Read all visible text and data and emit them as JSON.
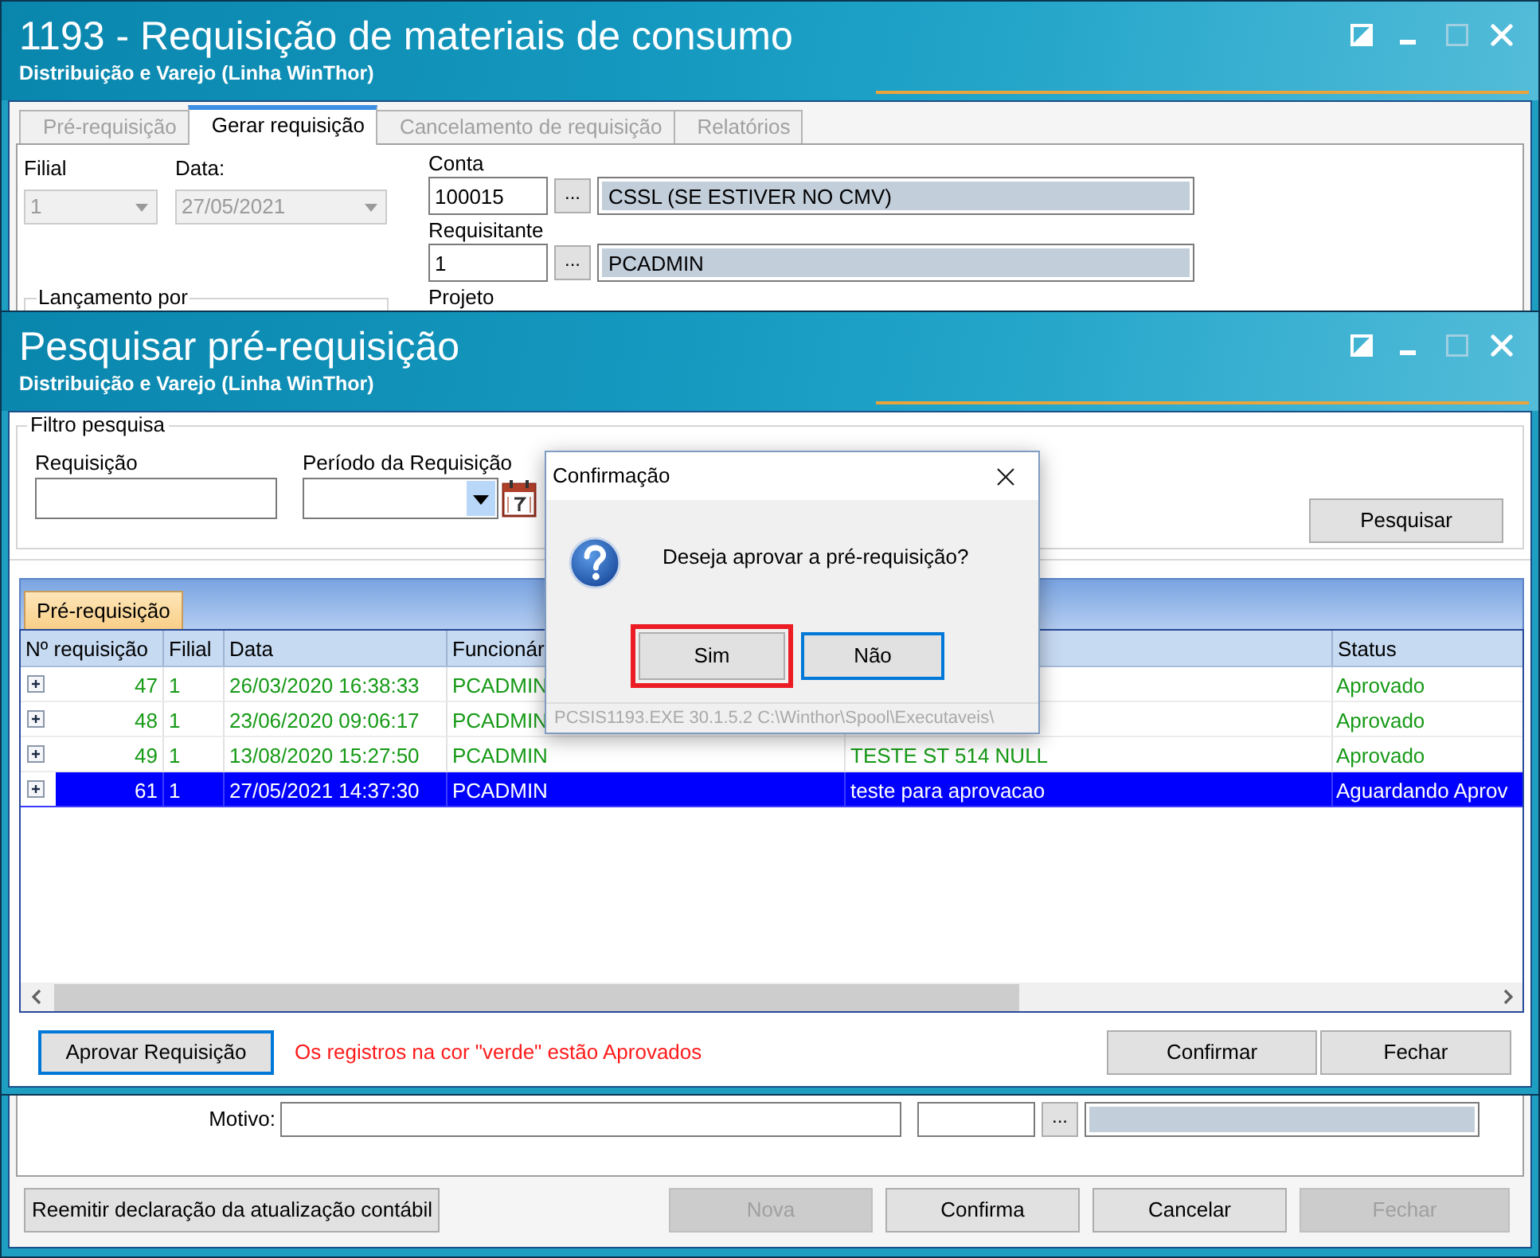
{
  "main_window": {
    "title": "1193 - Requisição de materiais de consumo",
    "subtitle": "Distribuição e Varejo (Linha WinThor)",
    "controls": [
      {
        "kind": "snap",
        "disabled": false
      },
      {
        "kind": "minimize",
        "disabled": false
      },
      {
        "kind": "maximize",
        "disabled": true
      },
      {
        "kind": "close",
        "disabled": false
      }
    ],
    "tabs": [
      {
        "label": "Pré-requisição",
        "selected": false,
        "disabled": true
      },
      {
        "label": "Gerar requisição",
        "selected": true,
        "disabled": false
      },
      {
        "label": "Cancelamento de requisição",
        "selected": false,
        "disabled": true
      },
      {
        "label": "Relatórios",
        "selected": false,
        "disabled": true
      }
    ],
    "filial": {
      "label": "Filial",
      "value": "1",
      "disabled": true
    },
    "data": {
      "label": "Data:",
      "value": "27/05/2021",
      "disabled": true
    },
    "lookups": [
      {
        "label": "Conta",
        "code": "100015",
        "button": "...",
        "description": "CSSL (SE ESTIVER NO CMV)"
      },
      {
        "label": "Requisitante",
        "code": "1",
        "button": "...",
        "description": "PCADMIN"
      }
    ],
    "projeto": {
      "label": "Projeto"
    },
    "group_label": "Lançamento por",
    "motivo": {
      "label": "Motivo:",
      "button": "..."
    },
    "buttons": [
      {
        "label": "Reemitir declaração da atualização contábil",
        "disabled": false
      },
      {
        "label": "Nova",
        "disabled": true
      },
      {
        "label": "Confirma",
        "disabled": false
      },
      {
        "label": "Cancelar",
        "disabled": false
      },
      {
        "label": "Fechar",
        "disabled": true
      }
    ]
  },
  "search_window": {
    "title": "Pesquisar pré-requisição",
    "subtitle": "Distribuição e Varejo (Linha WinThor)",
    "controls": [
      {
        "kind": "snap",
        "disabled": false
      },
      {
        "kind": "minimize",
        "disabled": false
      },
      {
        "kind": "maximize",
        "disabled": true
      },
      {
        "kind": "close",
        "disabled": false
      }
    ],
    "filter_label": "Filtro pesquisa",
    "requisicao": {
      "label": "Requisição"
    },
    "periodo": {
      "label": "Período da Requisição"
    },
    "search_button": "Pesquisar",
    "tabs": [
      {
        "label": "Pré-requisição",
        "selected": true
      }
    ],
    "columns": [
      "Nº requisição",
      "Filial",
      "Data",
      "Funcionár",
      null,
      "Status"
    ],
    "rows": [
      {
        "cells": [
          "47",
          "1",
          "26/03/2020 16:38:33",
          "PCADMIN",
          null,
          "Aprovado"
        ],
        "approved": true,
        "selected": false,
        "expanded": false
      },
      {
        "cells": [
          "48",
          "1",
          "23/06/2020 09:06:17",
          "PCADMIN",
          null,
          "Aprovado"
        ],
        "approved": true,
        "selected": false,
        "expanded": false
      },
      {
        "cells": [
          "49",
          "1",
          "13/08/2020 15:27:50",
          "PCADMIN",
          "TESTE ST 514 NULL",
          "Aprovado"
        ],
        "approved": true,
        "selected": false,
        "expanded": false
      },
      {
        "cells": [
          "61",
          "1",
          "27/05/2021 14:37:30",
          "PCADMIN",
          "teste para aprovacao",
          "Aguardando Aprov"
        ],
        "approved": false,
        "selected": true,
        "expanded": false
      }
    ],
    "approve_button": {
      "label": "Aprovar Requisição",
      "focused": true
    },
    "notice": "Os registros na cor \"verde\" estão Aprovados",
    "buttons": [
      "Confirmar",
      "Fechar"
    ]
  },
  "dialog": {
    "title": "Confirmação",
    "message": "Deseja aprovar a pré-requisição?",
    "buttons": [
      {
        "label": "Sim",
        "default": false,
        "highlighted": true
      },
      {
        "label": "Não",
        "default": true,
        "highlighted": false
      }
    ],
    "footer": "PCSIS1193.EXE 30.1.5.2 C:\\Winthor\\Spool\\Executaveis\\"
  }
}
